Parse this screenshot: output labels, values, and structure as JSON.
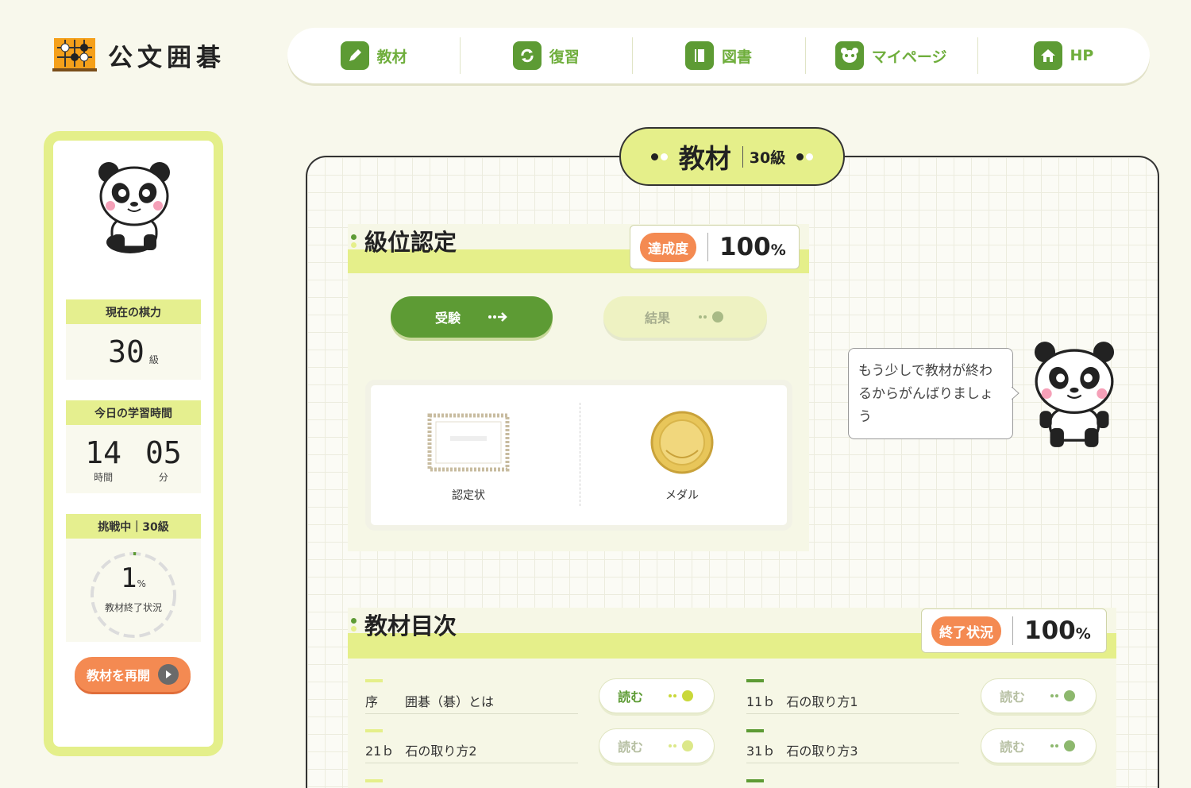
{
  "header": {
    "logo_text": "公文囲碁",
    "nav": [
      {
        "label": "教材",
        "icon": "pencil-icon"
      },
      {
        "label": "復習",
        "icon": "refresh-icon"
      },
      {
        "label": "図書",
        "icon": "book-icon"
      },
      {
        "label": "マイページ",
        "icon": "panda-face-icon"
      },
      {
        "label": "HP",
        "icon": "home-icon"
      }
    ]
  },
  "sidebar": {
    "current_strength_label": "現在の棋力",
    "current_strength_value": "30",
    "current_strength_unit": "級",
    "study_time_label": "今日の学習時間",
    "hours": "14",
    "hours_unit": "時間",
    "minutes": "05",
    "minutes_unit": "分",
    "challenge_label": "挑戦中｜30級",
    "progress_value": "1",
    "progress_unit": "%",
    "progress_label": "教材終了状況",
    "progress_fraction": 0.01,
    "resume_label": "教材を再開"
  },
  "main": {
    "tab_title": "教材",
    "tab_rank": "30級",
    "rank_section": {
      "title": "級位認定",
      "badge": "達成度",
      "score": "100",
      "unit": "%",
      "exam_label": "受験",
      "result_label": "結果",
      "awards": [
        {
          "label": "認定状",
          "icon": "certificate-icon"
        },
        {
          "label": "メダル",
          "icon": "medal-icon"
        }
      ]
    },
    "toc_section": {
      "title": "教材目次",
      "badge": "終了状況",
      "score": "100",
      "unit": "%",
      "read_label": "読む",
      "items": [
        {
          "num": "序",
          "title": "囲碁（碁）とは"
        },
        {
          "num": "11ｂ",
          "title": "石の取り方1"
        },
        {
          "num": "21ｂ",
          "title": "石の取り方2"
        },
        {
          "num": "31ｂ",
          "title": "石の取り方3"
        }
      ]
    }
  },
  "speech": {
    "text": "もう少しで教材が終わるからがんばりましょう"
  },
  "colors": {
    "accent_green": "#5d9b34",
    "light_yellow": "#e5ef8a",
    "orange": "#f48a52"
  }
}
